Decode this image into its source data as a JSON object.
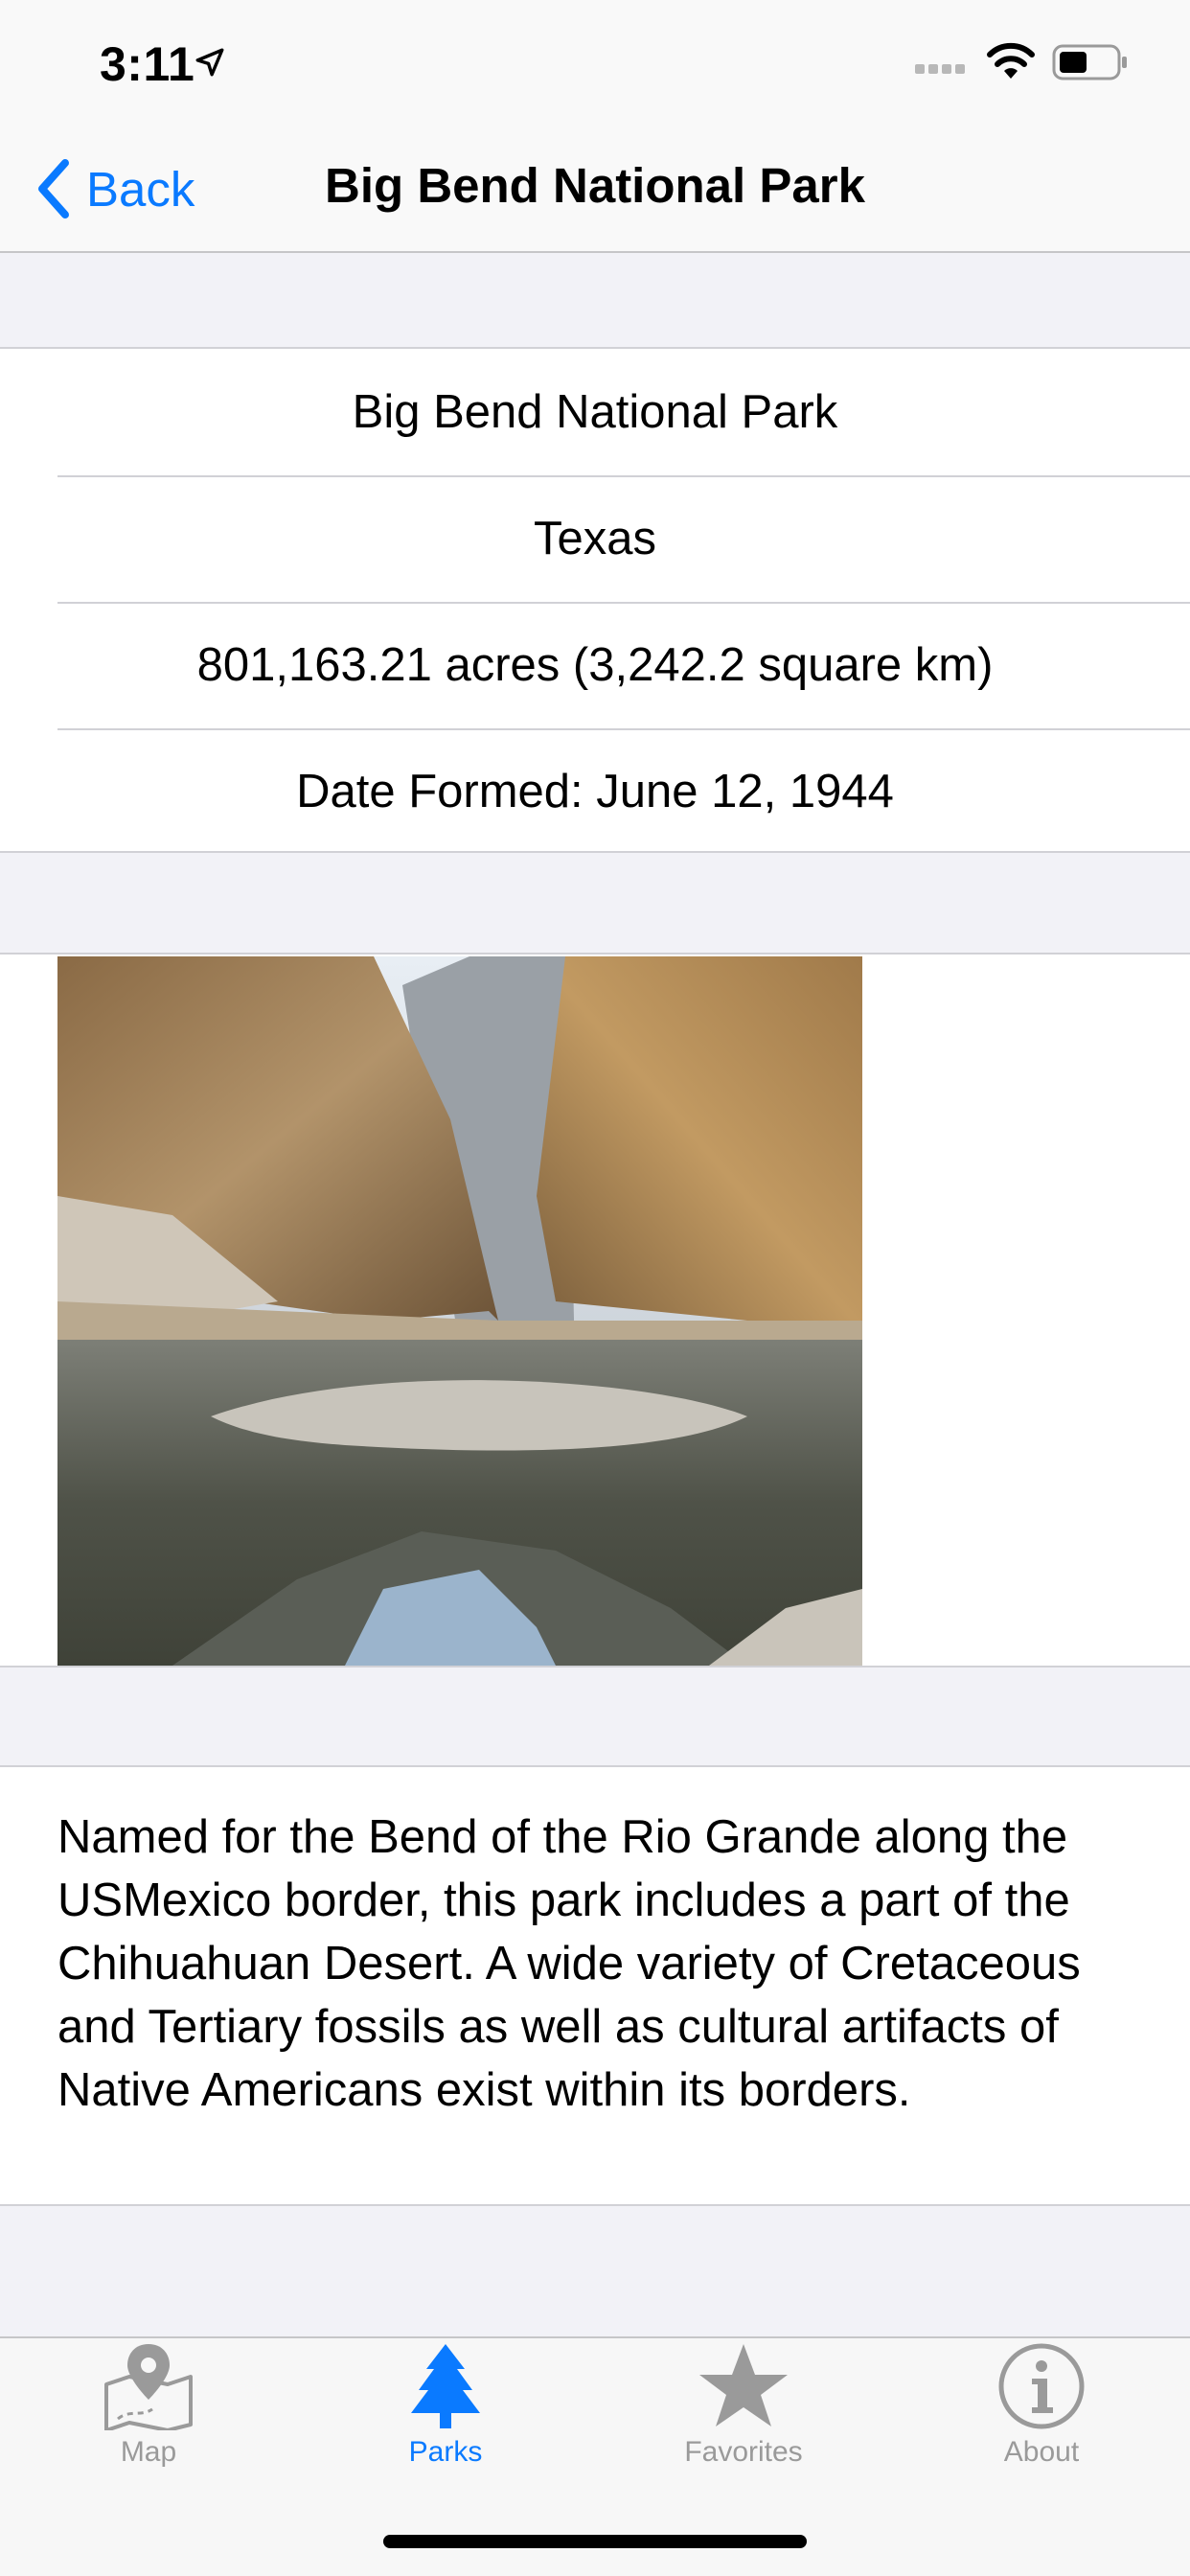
{
  "status_bar": {
    "time": "3:11"
  },
  "nav": {
    "back_label": "Back",
    "title": "Big Bend National Park"
  },
  "info": {
    "name": "Big Bend National Park",
    "state": "Texas",
    "area": "801,163.21 acres (3,242.2 square km)",
    "date_formed": "Date Formed: June 12, 1944"
  },
  "description": "Named for the Bend of the Rio Grande along the USMexico border, this park includes a part of the Chihuahuan Desert. A wide variety of Cretaceous and Tertiary fossils as well as cultural artifacts of Native Americans exist within its borders.",
  "tabs": [
    {
      "label": "Map",
      "icon": "map-icon",
      "active": false
    },
    {
      "label": "Parks",
      "icon": "tree-icon",
      "active": true
    },
    {
      "label": "Favorites",
      "icon": "star-icon",
      "active": false
    },
    {
      "label": "About",
      "icon": "info-icon",
      "active": false
    }
  ],
  "colors": {
    "accent": "#0a7aff",
    "inactive_tab": "#9a9a9a",
    "background": "#f2f2f7"
  }
}
